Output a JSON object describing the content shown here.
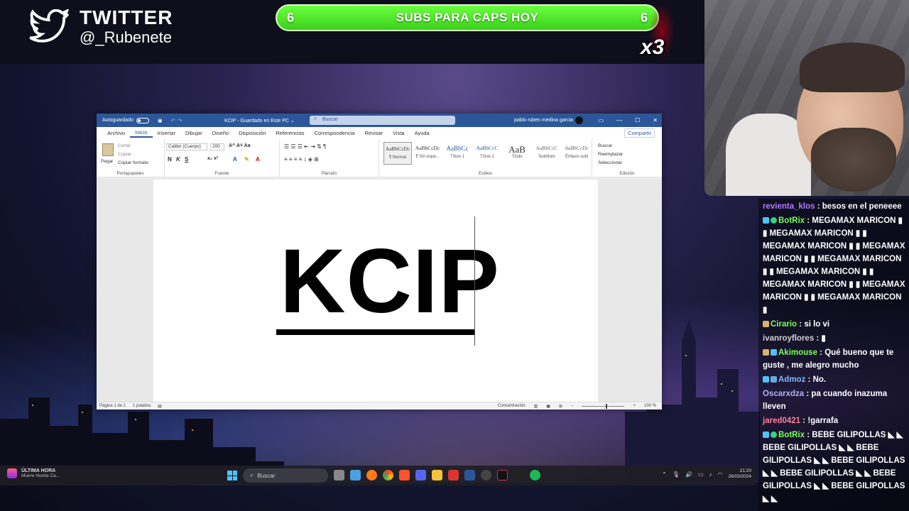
{
  "overlay": {
    "twitter_title": "TWITTER",
    "twitter_handle": "@_Rubenete",
    "goal_left": "6",
    "goal_text": "SUBS PARA CAPS HOY",
    "goal_right": "6",
    "multiplier": "x3"
  },
  "word": {
    "autosave_label": "Autoguardado",
    "doc_title": "KCIP  -  Guardado en Este PC  ⌄",
    "search_placeholder": "Buscar",
    "user_name": "pablo ruben medina garcia",
    "tabs": [
      "Archivo",
      "Inicio",
      "Insertar",
      "Dibujar",
      "Diseño",
      "Disposición",
      "Referencias",
      "Correspondencia",
      "Revisar",
      "Vista",
      "Ayuda"
    ],
    "share_label": "Compartir",
    "clipboard": {
      "paste": "Pegar",
      "cut": "Cortar",
      "copy": "Copiar",
      "format_painter": "Copiar formato",
      "group": "Portapapeles"
    },
    "font": {
      "name": "Calibri (Cuerpo)",
      "size": "200",
      "group": "Fuente"
    },
    "paragraph_group": "Párrafo",
    "styles": [
      {
        "preview": "AaBbCcDc",
        "name": "¶ Normal"
      },
      {
        "preview": "AaBbCcDc",
        "name": "¶ Sin espa..."
      },
      {
        "preview": "AaBbCc",
        "name": "Título 1"
      },
      {
        "preview": "AaBbCcC",
        "name": "Título 2"
      },
      {
        "preview": "AaB",
        "name": "Título"
      },
      {
        "preview": "AaBbCcC",
        "name": "Subtítulo"
      },
      {
        "preview": "AaBbCcDc",
        "name": "Énfasis sutil"
      }
    ],
    "styles_group": "Estilos",
    "editing": {
      "find": "Buscar",
      "replace": "Reemplazar",
      "select": "Seleccionar",
      "group": "Edición"
    },
    "document_text": "KCIP",
    "status": {
      "page": "Página 1 de 1",
      "words": "1 palabra",
      "focus": "Concentración",
      "zoom": "100 %"
    }
  },
  "taskbar": {
    "news_title": "ÚLTIMA HORA",
    "news_sub": "Muere Noelia Ca...",
    "search": "Buscar",
    "time": "21:20",
    "date": "26/03/2024"
  },
  "chat": [
    {
      "user": "revienta_klos",
      "color": "#b07cff",
      "text": "besos en el peneeee"
    },
    {
      "user": "BotRix",
      "color": "#7cff5a",
      "text": "MEGAMAX MARICON ▮ ▮ MEGAMAX MARICON ▮ ▮ MEGAMAX MARICON ▮ ▮ MEGAMAX MARICON ▮ ▮ MEGAMAX MARICON ▮ ▮ MEGAMAX MARICON ▮ ▮ MEGAMAX MARICON ▮ ▮ MEGAMAX MARICON ▮ ▮ MEGAMAX MARICON ▮"
    },
    {
      "user": "Cirario",
      "color": "#7cff5a",
      "text": "si lo vi"
    },
    {
      "user": "ivanroyflores",
      "color": "#d0d0d0",
      "text": "▮"
    },
    {
      "user": "Akimouse",
      "color": "#7cff5a",
      "text": "Qué bueno que te guste , me alegro mucho"
    },
    {
      "user": "Admoz",
      "color": "#7fb8ff",
      "text": "No."
    },
    {
      "user": "Oscarxdza",
      "color": "#b0b0ff",
      "text": "pa cuando inazuma lleven"
    },
    {
      "user": "jared0421",
      "color": "#ff7fa0",
      "text": "!garrafa"
    },
    {
      "user": "BotRix",
      "color": "#7cff5a",
      "text": "BEBE GILIPOLLAS ◣ ◣ BEBE GILIPOLLAS ◣ ◣ BEBE GILIPOLLAS ◣ ◣ BEBE GILIPOLLAS ◣ ◣ BEBE GILIPOLLAS ◣ ◣ BEBE GILIPOLLAS ◣ ◣ BEBE GILIPOLLAS ◣ ◣"
    }
  ]
}
